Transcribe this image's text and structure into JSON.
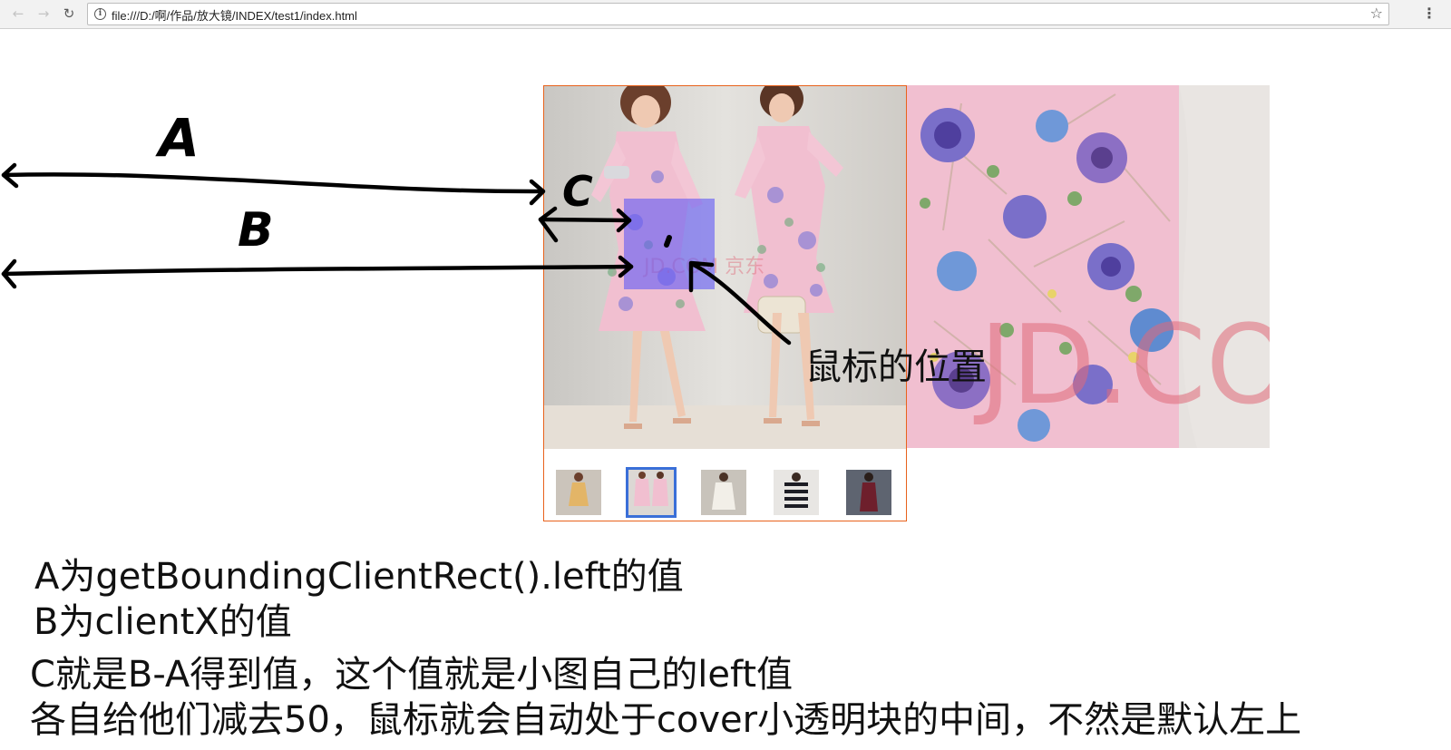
{
  "browser": {
    "url": "file:///D:/啊/作品/放大镜/INDEX/test1/index.html",
    "icons": [
      "back-arrow-icon",
      "forward-arrow-icon",
      "reload-icon",
      "info-icon",
      "bookmark-star-icon",
      "menu-icon"
    ],
    "back_glyph": "←",
    "forward_glyph": "→",
    "reload_glyph": "↻",
    "info_glyph": "i",
    "star_glyph": "☆",
    "menu_glyph": "⋮"
  },
  "annotations": {
    "a": "A",
    "b": "B",
    "c": "C",
    "mouse_position": "鼠标的位置"
  },
  "watermarks": {
    "small": "JD.COM 京东",
    "big": "JD.CO"
  },
  "explanation": {
    "line1": "A为getBoundingClientRect().left的值",
    "line2": "B为clientX的值",
    "line3": "C就是B-A得到值，这个值就是小图自己的left值",
    "line4": "各自给他们减去50，鼠标就会自动处于cover小透明块的中间，不然是默认左上"
  },
  "thumbnails": [
    {
      "name": "thumb-yellow-dress",
      "selected": false
    },
    {
      "name": "thumb-pink-floral-dress",
      "selected": true
    },
    {
      "name": "thumb-white-dress",
      "selected": false
    },
    {
      "name": "thumb-striped-top",
      "selected": false
    },
    {
      "name": "thumb-burgundy-dress",
      "selected": false
    }
  ],
  "colors": {
    "frame_border": "#e8621c",
    "thumb_selected": "#3a6fd8",
    "cover_mask": "#645cf5",
    "dress_pink": "#f1bfd0"
  }
}
